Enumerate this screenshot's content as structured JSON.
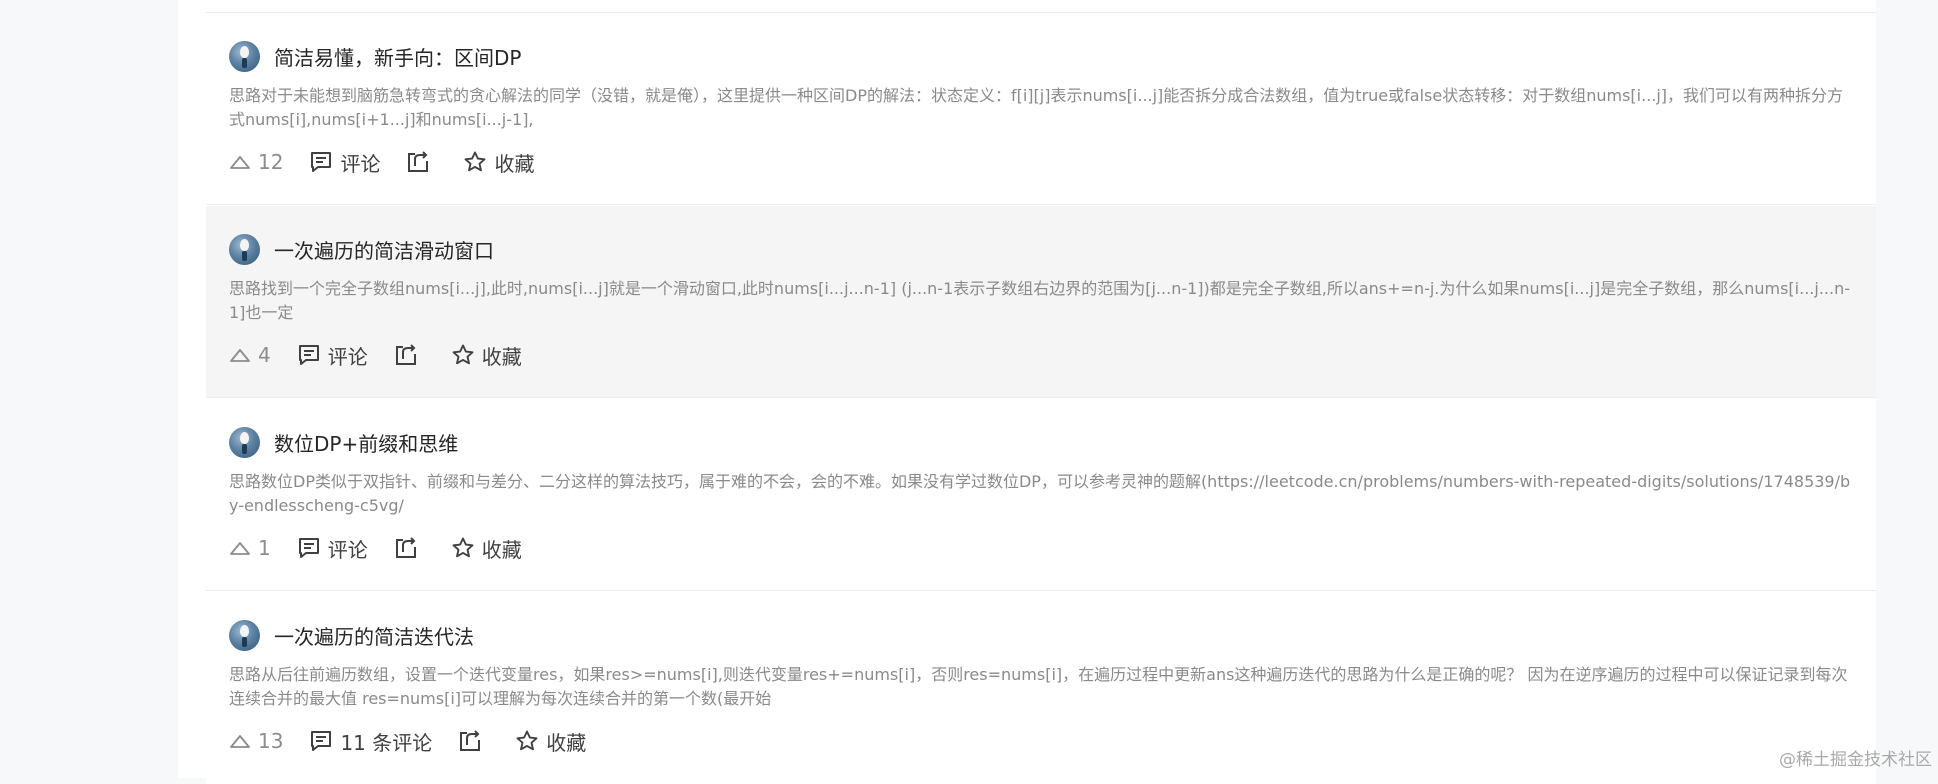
{
  "posts": [
    {
      "title": "简洁易懂，新手向：区间DP",
      "excerpt": "思路对于未能想到脑筋急转弯式的贪心解法的同学（没错，就是俺），这里提供一种区间DP的解法：状态定义：f[i][j]表示nums[i...j]能否拆分成合法数组，值为true或false状态转移：对于数组nums[i...j]，我们可以有两种拆分方式nums[i],nums[i+1...j]和nums[i...j-1],",
      "likes": "12",
      "comments": "评论",
      "favorite": "收藏"
    },
    {
      "title": "一次遍历的简洁滑动窗口",
      "excerpt": "思路找到一个完全子数组nums[i...j],此时,nums[i...j]就是一个滑动窗口,此时nums[i...j...n-1] (j...n-1表示子数组右边界的范围为[j...n-1])都是完全子数组,所以ans+=n-j.为什么如果nums[i...j]是完全子数组，那么nums[i...j...n-1]也一定",
      "likes": "4",
      "comments": "评论",
      "favorite": "收藏"
    },
    {
      "title": "数位DP+前缀和思维",
      "excerpt": "思路数位DP类似于双指针、前缀和与差分、二分这样的算法技巧，属于难的不会，会的不难。如果没有学过数位DP，可以参考灵神的题解(https://leetcode.cn/problems/numbers-with-repeated-digits/solutions/1748539/by-endlesscheng-c5vg/",
      "likes": "1",
      "comments": "评论",
      "favorite": "收藏"
    },
    {
      "title": "一次遍历的简洁迭代法",
      "excerpt": "思路从后往前遍历数组，设置一个迭代变量res，如果res>=nums[i],则迭代变量res+=nums[i]，否则res=nums[i]，在遍历过程中更新ans这种遍历迭代的思路为什么是正确的呢？ 因为在逆序遍历的过程中可以保证记录到每次连续合并的最大值 res=nums[i]可以理解为每次连续合并的第一个数(最开始",
      "likes": "13",
      "comments": "11 条评论",
      "favorite": "收藏"
    }
  ],
  "watermark": "@稀土掘金技术社区",
  "icons": {
    "like": "thumb-up-outline-icon",
    "comment": "comment-bubble-icon",
    "share": "share-icon",
    "favorite": "star-outline-icon"
  },
  "colors": {
    "page_bg": "#f7f8fa",
    "card_bg": "#ffffff",
    "hover_bg": "#f5f5f5",
    "excerpt": "#8a8a8a",
    "title": "#262626"
  }
}
